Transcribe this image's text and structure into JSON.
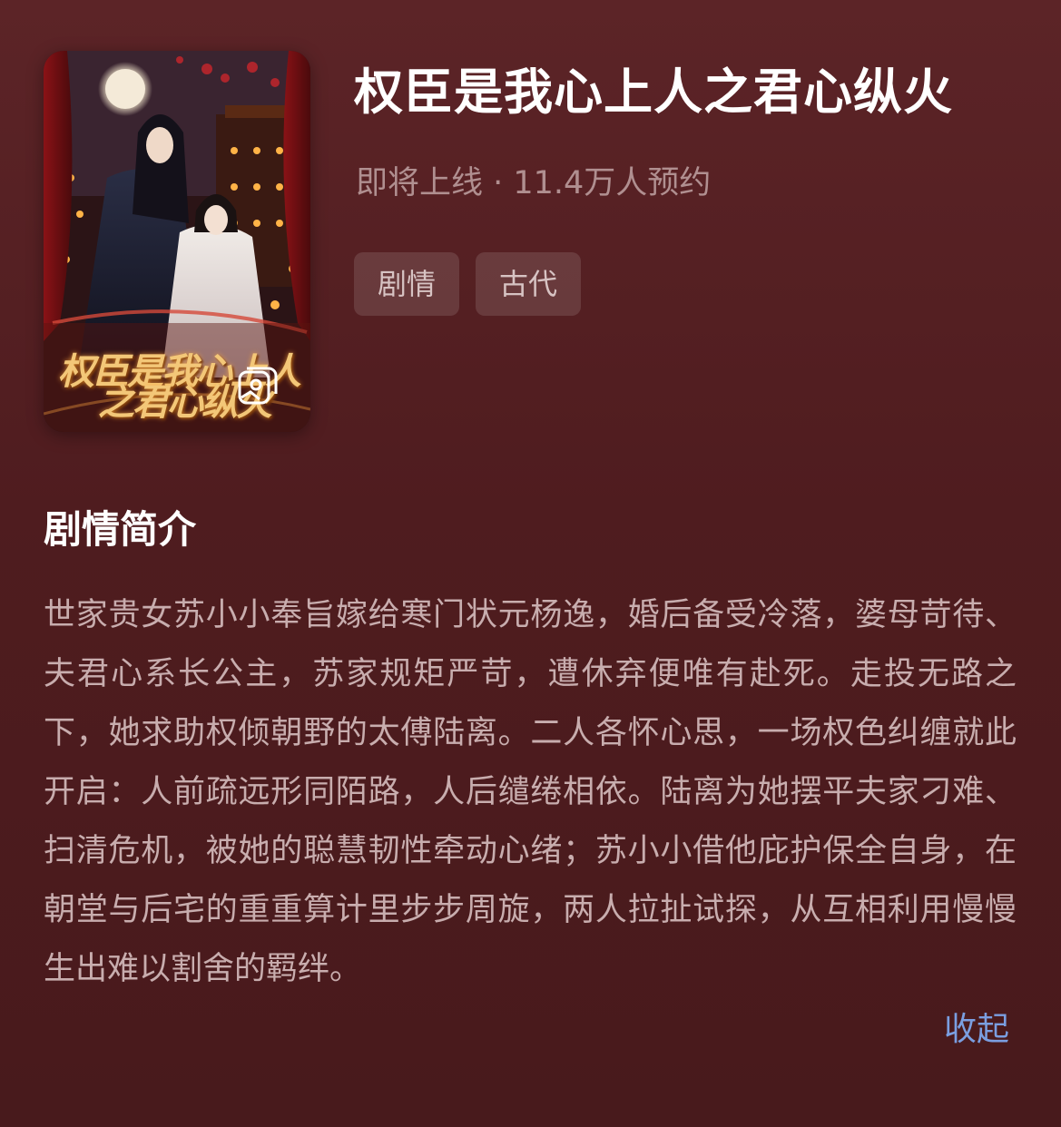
{
  "drama": {
    "title": "权臣是我心上人之君心纵火",
    "meta": "即将上线 · 11.4万人预约",
    "tags": [
      "剧情",
      "古代"
    ]
  },
  "poster": {
    "title_art_line1": "权臣是我心上人",
    "title_art_line2": "之君心纵火",
    "gallery_icon": "image-gallery-icon"
  },
  "synopsis": {
    "heading": "剧情简介",
    "body": "世家贵女苏小小奉旨嫁给寒门状元杨逸，婚后备受冷落，婆母苛待、夫君心系长公主，苏家规矩严苛，遭休弃便唯有赴死。走投无路之下，她求助权倾朝野的太傅陆离。二人各怀心思，一场权色纠缠就此开启：人前疏远形同陌路，人后缱绻相依。陆离为她摆平夫家刁难、扫清危机，被她的聪慧韧性牵动心绪；苏小小借他庇护保全自身，在朝堂与后宅的重重算计里步步周旋，两人拉扯试探，从互相利用慢慢生出难以割舍的羁绊。",
    "collapse_label": "收起"
  },
  "colors": {
    "background": "#4f1c1f",
    "meta_text": "#b08f90",
    "body_text": "#c8adae",
    "link": "#7a9ee0",
    "poster_gold": "#f3c778"
  }
}
